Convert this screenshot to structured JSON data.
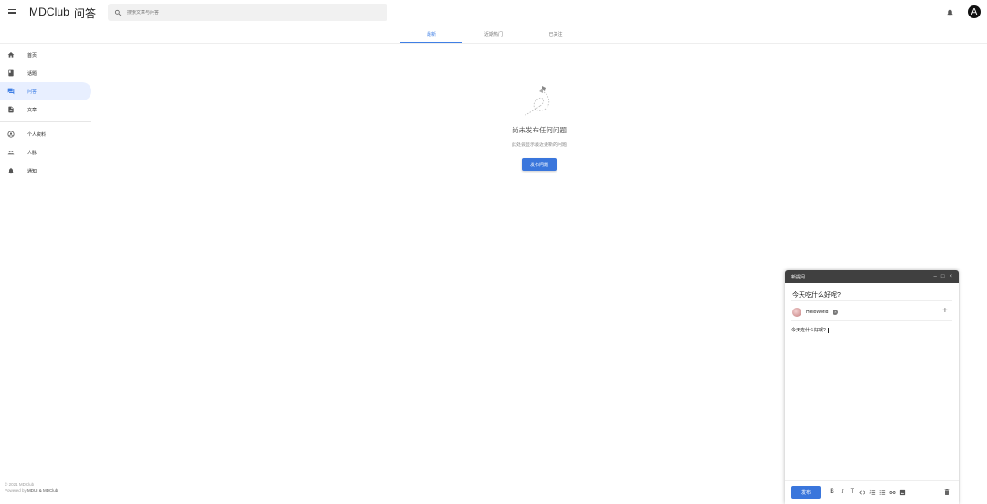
{
  "app": {
    "brand": "MDClub",
    "section": "问答",
    "avatar_letter": "A"
  },
  "search": {
    "placeholder": "搜索文章与问答"
  },
  "tabs": [
    {
      "label": "最新",
      "active": true
    },
    {
      "label": "近期热门",
      "active": false
    },
    {
      "label": "已关注",
      "active": false
    }
  ],
  "sidebar": {
    "items": [
      {
        "label": "首页",
        "icon": "home-icon"
      },
      {
        "label": "话题",
        "icon": "book-icon"
      },
      {
        "label": "问答",
        "icon": "forum-icon",
        "active": true
      },
      {
        "label": "文章",
        "icon": "article-icon"
      },
      {
        "label": "个人资料",
        "icon": "account-circle-icon"
      },
      {
        "label": "人脉",
        "icon": "people-icon"
      },
      {
        "label": "通知",
        "icon": "bell-icon"
      }
    ]
  },
  "footer": {
    "copyright": "© 2021 MDClub",
    "powered_prefix": "Powered by ",
    "powered_by": "MDUI & MDClub"
  },
  "empty_state": {
    "title": "尚未发布任何问题",
    "description": "此处会显示最近更新的问题",
    "button": "发布问题"
  },
  "editor": {
    "header_title": "新提问",
    "title_value": "今天吃什么好呢?",
    "topic_chip": "HelloWorld",
    "body_text": "今天吃什么好呢?",
    "send_label": "发布",
    "toolbar": [
      "B",
      "I",
      "T"
    ]
  },
  "colors": {
    "accent": "#3f7fe5",
    "button": "#3a76dc",
    "active_nav_bg": "#e8efff",
    "editor_header": "#404040"
  }
}
